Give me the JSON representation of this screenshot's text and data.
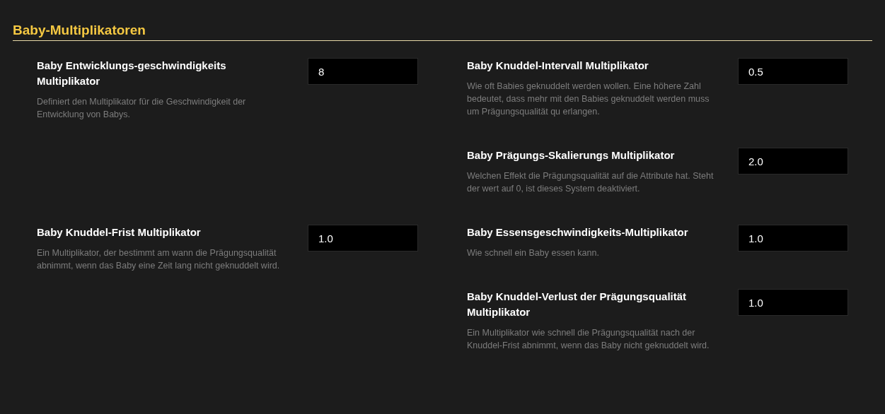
{
  "section": {
    "title": "Baby-Multiplikatoren"
  },
  "rows": [
    {
      "left": [
        {
          "label": "Baby Entwicklungs-geschwindigkeits Multiplikator",
          "description": "Definiert den Multiplikator für die Geschwindigkeit der Entwicklung von Babys.",
          "value": "8"
        }
      ],
      "right": [
        {
          "label": "Baby Knuddel-Intervall Multiplikator",
          "description": "Wie oft Babies geknuddelt werden wollen. Eine höhere Zahl bedeutet, dass mehr mit den Babies geknuddelt werden muss um Prägungsqualität qu erlangen.",
          "value": "0.5"
        },
        {
          "label": "Baby Prägungs-Skalierungs Multiplikator",
          "description": "Welchen Effekt die Prägungsqualität auf die Attribute hat. Steht der wert auf 0, ist dieses System deaktiviert.",
          "value": "2.0"
        }
      ]
    },
    {
      "left": [
        {
          "label": "Baby Knuddel-Frist Multiplikator",
          "description": "Ein Multiplikator, der bestimmt am wann die Prägungsqualität abnimmt, wenn das Baby eine Zeit lang nicht geknuddelt wird.",
          "value": "1.0"
        }
      ],
      "right": [
        {
          "label": "Baby Essensgeschwindigkeits-Multiplikator",
          "description": "Wie schnell ein Baby essen kann.",
          "value": "1.0"
        },
        {
          "label": "Baby Knuddel-Verlust der Prägungsqualität Multiplikator",
          "description": "Ein Multiplikator wie schnell die Prägungsqualität nach der Knuddel-Frist abnimmt, wenn das Baby nicht geknuddelt wird.",
          "value": "1.0"
        }
      ]
    }
  ]
}
